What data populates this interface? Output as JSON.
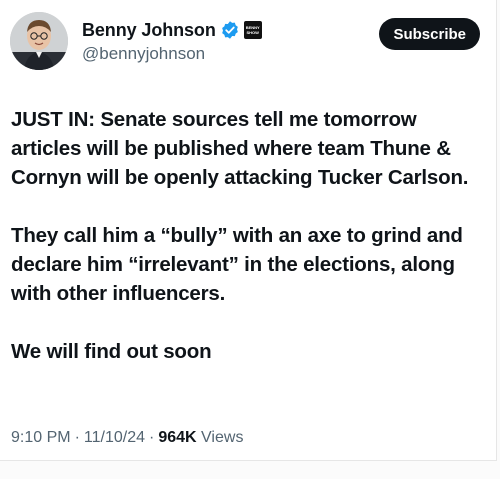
{
  "author": {
    "display_name": "Benny Johnson",
    "handle": "@bennyjohnson",
    "affiliation_badge": "BENNY SHOW"
  },
  "subscribe_label": "Subscribe",
  "tweet": {
    "paragraphs": [
      "JUST IN: Senate sources tell me tomorrow articles will be published where team Thune & Cornyn will be openly attacking Tucker Carlson.",
      "They call him a “bully” with an axe to grind and declare him “irrelevant” in the elections, along with other influencers.",
      "We will find out soon"
    ]
  },
  "meta": {
    "time": "9:10 PM",
    "separator": "·",
    "date": "11/10/24",
    "views_count": "964K",
    "views_label": "Views"
  },
  "colors": {
    "text": "#0f1419",
    "secondary": "#536471",
    "verified": "#1d9bf0",
    "button_bg": "#0f1419"
  },
  "icons": {
    "verified": "verified-badge-icon",
    "avatar": "profile-avatar"
  }
}
